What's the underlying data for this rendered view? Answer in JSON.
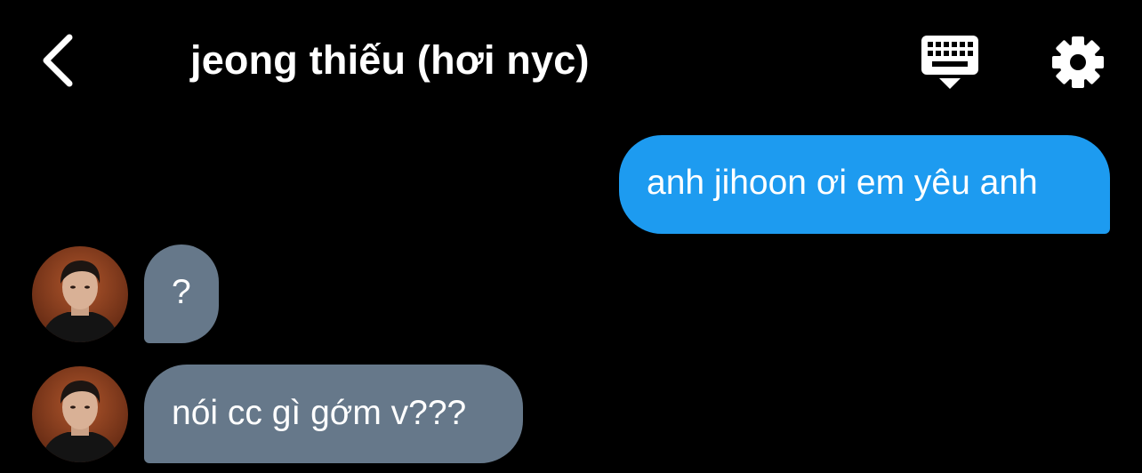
{
  "header": {
    "title": "jeong thiếu (hơi nyc)",
    "back_icon": "chevron-left-icon",
    "keyboard_icon": "keyboard-icon",
    "settings_icon": "gear-icon"
  },
  "messages": [
    {
      "direction": "sent",
      "text": "anh jihoon ơi em yêu anh"
    },
    {
      "direction": "received",
      "text": "?"
    },
    {
      "direction": "received",
      "text": "nói cc gì gớm v???"
    }
  ],
  "colors": {
    "background": "#000000",
    "sent_bubble": "#1d9bf0",
    "received_bubble": "#66788a",
    "text": "#ffffff"
  }
}
